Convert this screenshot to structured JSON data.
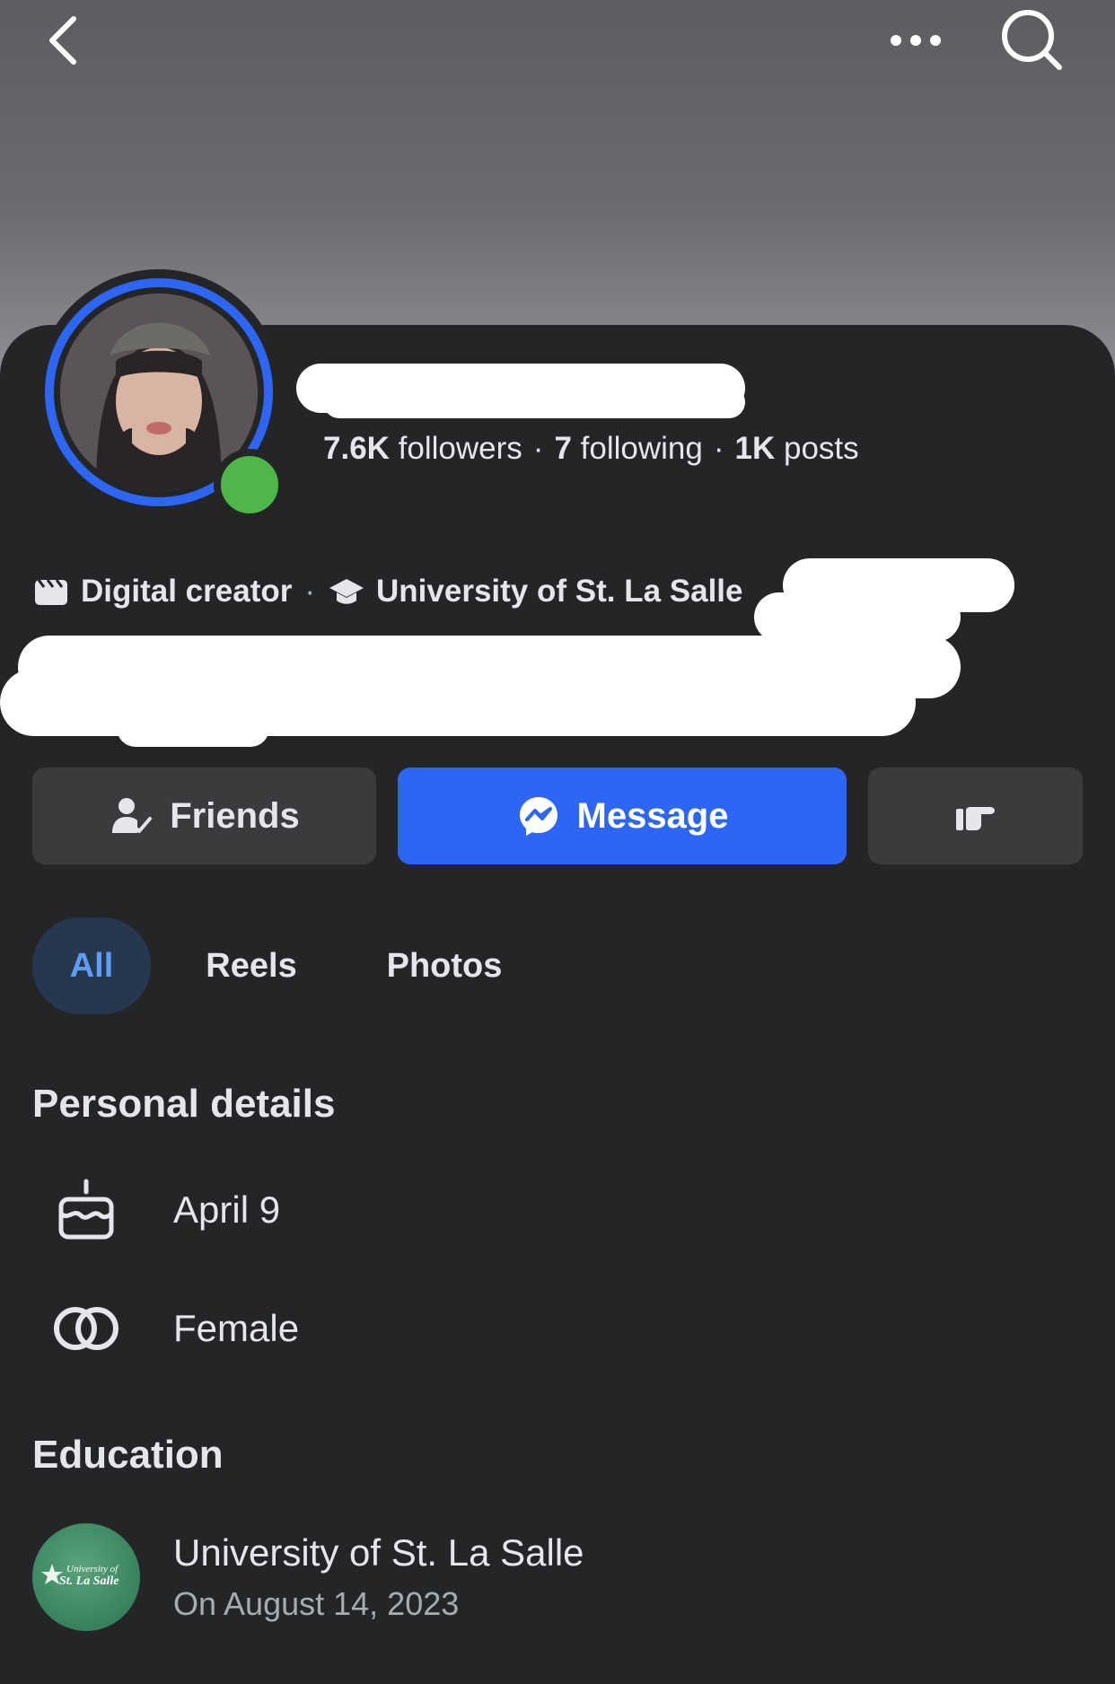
{
  "header": {
    "back_icon": "chevron-left-icon",
    "more_icon": "more-horizontal-icon",
    "search_icon": "search-icon"
  },
  "profile": {
    "followers_count": "7.6K",
    "followers_label": "followers",
    "following_count": "7",
    "following_label": "following",
    "posts_count": "1K",
    "posts_label": "posts",
    "separator": "·",
    "category": "Digital creator",
    "school": "University of St. La Salle",
    "meta_separator": "·",
    "online_color": "#4fb74a",
    "ring_color": "#2c66f2"
  },
  "actions": {
    "friends_label": "Friends",
    "message_label": "Message",
    "poke_icon": "poke-hand-icon"
  },
  "tabs": [
    {
      "label": "All",
      "active": true
    },
    {
      "label": "Reels",
      "active": false
    },
    {
      "label": "Photos",
      "active": false
    }
  ],
  "personal_details": {
    "title": "Personal details",
    "birthday": "April 9",
    "gender": "Female"
  },
  "education": {
    "title": "Education",
    "school": "University of St. La Salle",
    "date": "On August 14, 2023",
    "logo_text": "University of St. La Salle"
  },
  "colors": {
    "accent": "#2d66f5",
    "active_tab_bg": "#263850",
    "active_tab_text": "#5f9cf5",
    "background": "#242527"
  }
}
